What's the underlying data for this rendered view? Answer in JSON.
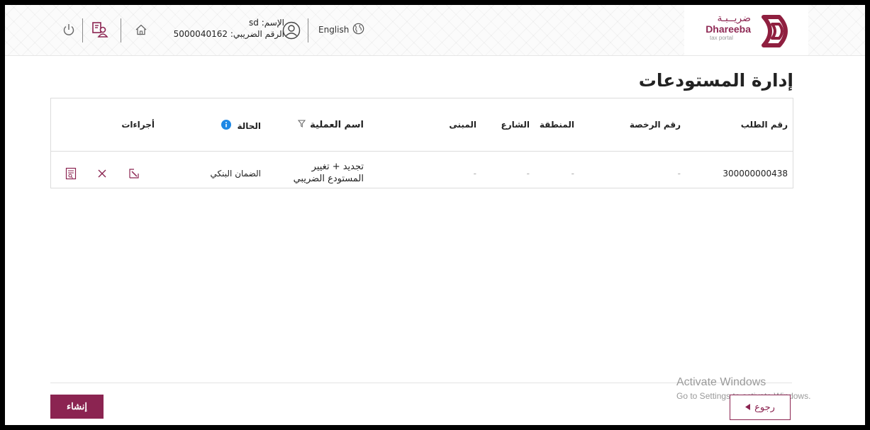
{
  "header": {
    "user_name": "الإسم: sd",
    "tax_number": "الرقم الضريبي: 5000040162",
    "language": "English",
    "logo_ar": "ضريــبـة",
    "logo_en": "Dhareeba",
    "logo_sub": "tax portal"
  },
  "page": {
    "title": "إدارة المستودعات"
  },
  "table": {
    "columns": {
      "request_no": "رقم الطلب",
      "license_no": "رقم الرخصة",
      "area": "المنطقة",
      "street": "الشارع",
      "building": "المبنى",
      "operation_name": "اسم العملية",
      "status": "الحالة",
      "actions": "أجراءات"
    },
    "rows": [
      {
        "request_no": "300000000438",
        "license_no": "-",
        "area": "-",
        "street": "-",
        "building": "-",
        "operation_line1": "تجديد + تغيير",
        "operation_line2": "المستودع الضريبي",
        "status": "الضمان البنكي"
      }
    ]
  },
  "footer": {
    "create_label": "إنشاء",
    "back_label": "رجوع"
  },
  "watermark": {
    "line1": "Activate Windows",
    "line2": "Go to Settings to activate Windows."
  },
  "colors": {
    "brand": "#8b2451",
    "info": "#1e88e5"
  }
}
